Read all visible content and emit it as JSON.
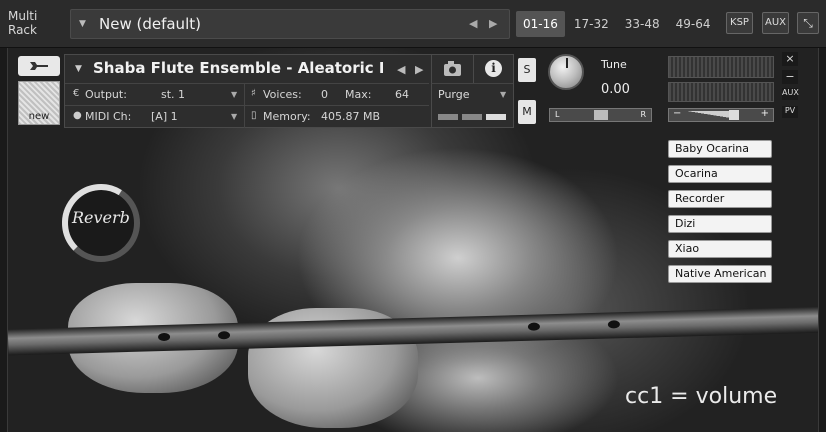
{
  "rack": {
    "label_line1": "Multi",
    "label_line2": "Rack"
  },
  "preset": {
    "dropdown_glyph": "▼",
    "name": "New (default)",
    "prev": "◀",
    "next": "▶"
  },
  "tabs": [
    {
      "label": "01-16",
      "active": true
    },
    {
      "label": "17-32",
      "active": false
    },
    {
      "label": "33-48",
      "active": false
    },
    {
      "label": "49-64",
      "active": false
    }
  ],
  "top_buttons": {
    "ksp": "KSP",
    "aux": "AUX",
    "collapse": "⤡"
  },
  "instrument": {
    "dropdown_glyph": "▼",
    "name": "Shaba Flute Ensemble - Aleatoric Hi",
    "prev": "◀",
    "next": "▶",
    "info": "i",
    "new_label": "new",
    "output_icon": "€",
    "output_label": "Output:",
    "output_value": "st. 1",
    "voices_icon": "♯",
    "voices_label": "Voices:",
    "voices_value": "0",
    "max_label": "Max:",
    "max_value": "64",
    "midi_icon": "●",
    "midi_label": "MIDI Ch:",
    "midi_value": "[A]  1",
    "memory_icon": "▯",
    "memory_label": "Memory:",
    "memory_value": "405.87 MB",
    "purge_label": "Purge",
    "caret": "▼"
  },
  "controls": {
    "solo": "S",
    "mute": "M",
    "tune_label": "Tune",
    "tune_value": "0.00",
    "pan_left": "L",
    "pan_right": "R",
    "vol_minus": "−",
    "vol_plus": "+",
    "close": "×",
    "minimize": "−",
    "aux_mini": "AUX",
    "pv_mini": "PV"
  },
  "reverb": {
    "label": "Reverb",
    "level": 0.62
  },
  "articulations": [
    "Baby Ocarina",
    "Ocarina",
    "Recorder",
    "Dizi",
    "Xiao",
    "Native American"
  ],
  "note": "cc1 = volume"
}
